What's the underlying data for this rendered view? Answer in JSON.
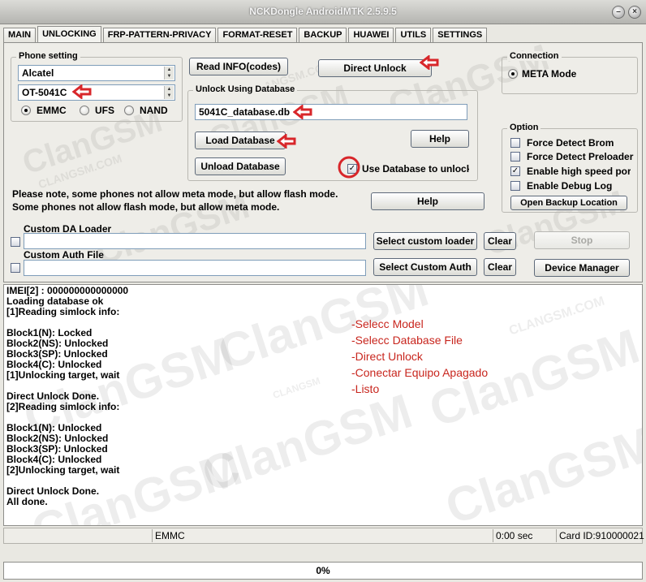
{
  "window": {
    "title": "NCKDongle AndroidMTK 2.5.9.5"
  },
  "tabs": [
    {
      "label": "MAIN",
      "active": false
    },
    {
      "label": "UNLOCKING",
      "active": true
    },
    {
      "label": "FRP-PATTERN-PRIVACY",
      "active": false
    },
    {
      "label": "FORMAT-RESET",
      "active": false
    },
    {
      "label": "BACKUP",
      "active": false
    },
    {
      "label": "HUAWEI",
      "active": false
    },
    {
      "label": "UTILS",
      "active": false
    },
    {
      "label": "SETTINGS",
      "active": false
    }
  ],
  "phone_setting": {
    "label": "Phone setting",
    "brand": "Alcatel",
    "model": "OT-5041C",
    "storage": {
      "emmc": "EMMC",
      "ufs": "UFS",
      "nand": "NAND",
      "selected": "EMMC"
    }
  },
  "buttons": {
    "read_info": "Read INFO(codes)",
    "direct_unlock": "Direct Unlock",
    "load_database": "Load Database",
    "unload_database": "Unload Database",
    "help_db": "Help",
    "help_main": "Help",
    "select_custom_loader": "Select custom loader",
    "select_custom_auth": "Select Custom Auth",
    "clear1": "Clear",
    "clear2": "Clear",
    "stop": "Stop",
    "device_manager": "Device Manager",
    "open_backup": "Open Backup Location"
  },
  "unlock_db": {
    "label": "Unlock Using Database",
    "file": "5041C_database.db",
    "use_db_label": "Use Database to unlock",
    "use_db_checked": true
  },
  "connection": {
    "label": "Connection",
    "mode": "META Mode"
  },
  "option": {
    "label": "Option",
    "items": [
      {
        "label": "Force Detect Brom",
        "checked": false
      },
      {
        "label": "Force Detect Preloader",
        "checked": false
      },
      {
        "label": "Enable high speed port",
        "checked": true
      },
      {
        "label": "Enable Debug Log",
        "checked": false
      }
    ]
  },
  "notes": {
    "line1": "Please note, some phones not allow meta mode, but allow flash mode.",
    "line2": "Some phones not allow flash mode, but allow meta mode."
  },
  "custom_da": {
    "label": "Custom DA Loader",
    "value": ""
  },
  "custom_auth": {
    "label": "Custom Auth File",
    "value": ""
  },
  "log": [
    "IMEI[2] : 000000000000000",
    "Loading database ok",
    "[1]Reading simlock info:",
    "",
    "Block1(N): Locked",
    "Block2(NS): Unlocked",
    "Block3(SP): Unlocked",
    "Block4(C): Unlocked",
    "[1]Unlocking target, wait",
    "",
    "Direct Unlock Done.",
    "[2]Reading simlock info:",
    "",
    "Block1(N): Unlocked",
    "Block2(NS): Unlocked",
    "Block3(SP): Unlocked",
    "Block4(C): Unlocked",
    "[2]Unlocking target, wait",
    "",
    "Direct Unlock Done.",
    "All done."
  ],
  "steps": [
    "-Selecc Model",
    "-Selecc Database File",
    "-Direct Unlock",
    "-Conectar Equipo Apagado",
    "-Listo"
  ],
  "status": {
    "storage": "EMMC",
    "time": "0:00 sec",
    "card_id": "Card ID:910000021"
  },
  "progress": {
    "text": "0%",
    "value": 0
  },
  "watermark": {
    "brand": "ClanGSM",
    "site": "CLANGSM.COM",
    "small": "CLANGSM"
  },
  "colors": {
    "accent_red": "#d8262a",
    "step_text": "#c8261e"
  }
}
